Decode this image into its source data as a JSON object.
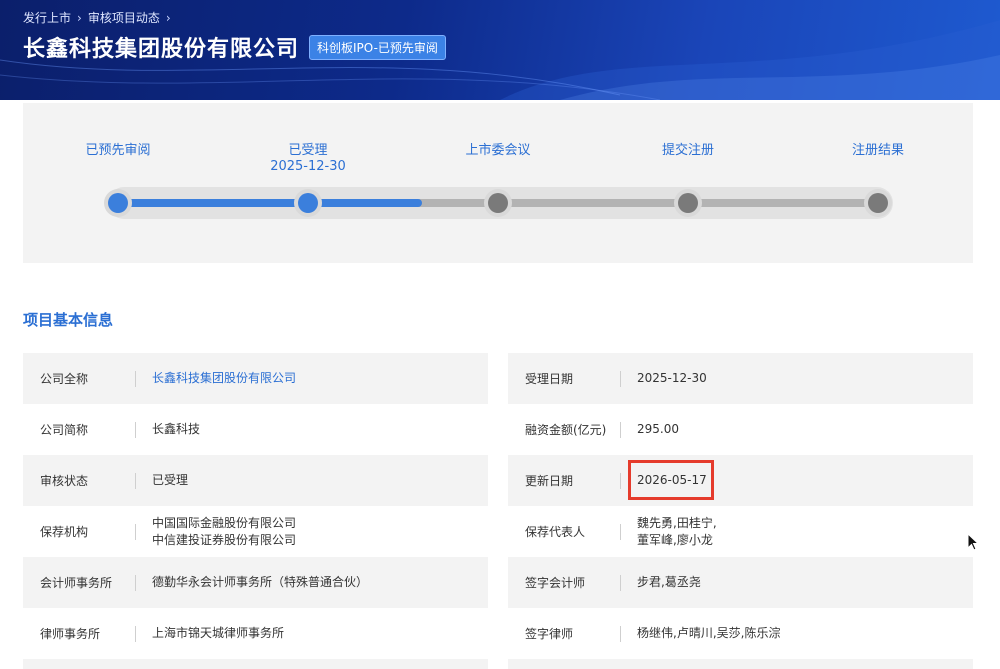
{
  "breadcrumb": {
    "item1": "发行上市",
    "item2": "审核项目动态"
  },
  "header": {
    "company_title": "长鑫科技集团股份有限公司",
    "board_badge": "科创板IPO-已预先审阅"
  },
  "progress": {
    "completed_fraction": 0.4,
    "steps": [
      {
        "label": "已预先审阅",
        "date": "",
        "status": "done"
      },
      {
        "label": "已受理",
        "date": "2025-12-30",
        "status": "done"
      },
      {
        "label": "上市委会议",
        "date": "",
        "status": "pending"
      },
      {
        "label": "提交注册",
        "date": "",
        "status": "pending"
      },
      {
        "label": "注册结果",
        "date": "",
        "status": "pending"
      }
    ]
  },
  "section": {
    "title": "项目基本信息"
  },
  "info_left": [
    {
      "label": "公司全称",
      "value": "长鑫科技集团股份有限公司",
      "value2": ""
    },
    {
      "label": "公司简称",
      "value": "长鑫科技",
      "value2": ""
    },
    {
      "label": "审核状态",
      "value": "已受理",
      "value2": ""
    },
    {
      "label": "保荐机构",
      "value": "中国国际金融股份有限公司",
      "value2": "中信建投证券股份有限公司"
    },
    {
      "label": "会计师事务所",
      "value": "德勤华永会计师事务所（特殊普通合伙）",
      "value2": ""
    },
    {
      "label": "律师事务所",
      "value": "上海市锦天城律师事务所",
      "value2": ""
    }
  ],
  "info_right": [
    {
      "label": "受理日期",
      "value": "2025-12-30",
      "value2": ""
    },
    {
      "label": "融资金额(亿元)",
      "value": "295.00",
      "value2": ""
    },
    {
      "label": "更新日期",
      "value": "2026-05-17",
      "value2": ""
    },
    {
      "label": "保荐代表人",
      "value": "魏先勇,田桂宁,",
      "value2": "董军峰,廖小龙"
    },
    {
      "label": "签字会计师",
      "value": "步君,葛丞尧",
      "value2": ""
    },
    {
      "label": "签字律师",
      "value": "杨继伟,卢晴川,吴莎,陈乐淙",
      "value2": ""
    }
  ],
  "colors": {
    "accent": "#2b6fd3",
    "highlight": "#e53b2c",
    "banner": "#0d2a8a"
  }
}
